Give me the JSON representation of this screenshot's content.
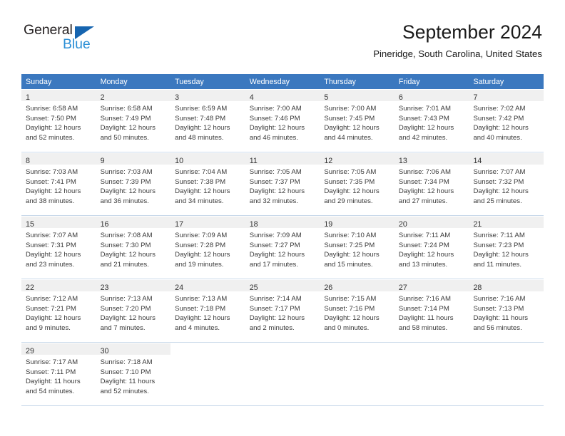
{
  "brand": {
    "name_part1": "General",
    "name_part2": "Blue",
    "accent_color": "#1665b0",
    "blue_text_color": "#2b8fd6"
  },
  "header": {
    "title": "September 2024",
    "location": "Pineridge, South Carolina, United States"
  },
  "theme": {
    "header_bar_color": "#3b78bf",
    "header_text_color": "#ffffff",
    "day_band_color": "#f0f0f0",
    "row_divider_color": "#c9d9ea",
    "body_text_color": "#3a3a3a"
  },
  "weekdays": [
    "Sunday",
    "Monday",
    "Tuesday",
    "Wednesday",
    "Thursday",
    "Friday",
    "Saturday"
  ],
  "weeks": [
    [
      {
        "day": "1",
        "sunrise": "Sunrise: 6:58 AM",
        "sunset": "Sunset: 7:50 PM",
        "daylight": "Daylight: 12 hours and 52 minutes."
      },
      {
        "day": "2",
        "sunrise": "Sunrise: 6:58 AM",
        "sunset": "Sunset: 7:49 PM",
        "daylight": "Daylight: 12 hours and 50 minutes."
      },
      {
        "day": "3",
        "sunrise": "Sunrise: 6:59 AM",
        "sunset": "Sunset: 7:48 PM",
        "daylight": "Daylight: 12 hours and 48 minutes."
      },
      {
        "day": "4",
        "sunrise": "Sunrise: 7:00 AM",
        "sunset": "Sunset: 7:46 PM",
        "daylight": "Daylight: 12 hours and 46 minutes."
      },
      {
        "day": "5",
        "sunrise": "Sunrise: 7:00 AM",
        "sunset": "Sunset: 7:45 PM",
        "daylight": "Daylight: 12 hours and 44 minutes."
      },
      {
        "day": "6",
        "sunrise": "Sunrise: 7:01 AM",
        "sunset": "Sunset: 7:43 PM",
        "daylight": "Daylight: 12 hours and 42 minutes."
      },
      {
        "day": "7",
        "sunrise": "Sunrise: 7:02 AM",
        "sunset": "Sunset: 7:42 PM",
        "daylight": "Daylight: 12 hours and 40 minutes."
      }
    ],
    [
      {
        "day": "8",
        "sunrise": "Sunrise: 7:03 AM",
        "sunset": "Sunset: 7:41 PM",
        "daylight": "Daylight: 12 hours and 38 minutes."
      },
      {
        "day": "9",
        "sunrise": "Sunrise: 7:03 AM",
        "sunset": "Sunset: 7:39 PM",
        "daylight": "Daylight: 12 hours and 36 minutes."
      },
      {
        "day": "10",
        "sunrise": "Sunrise: 7:04 AM",
        "sunset": "Sunset: 7:38 PM",
        "daylight": "Daylight: 12 hours and 34 minutes."
      },
      {
        "day": "11",
        "sunrise": "Sunrise: 7:05 AM",
        "sunset": "Sunset: 7:37 PM",
        "daylight": "Daylight: 12 hours and 32 minutes."
      },
      {
        "day": "12",
        "sunrise": "Sunrise: 7:05 AM",
        "sunset": "Sunset: 7:35 PM",
        "daylight": "Daylight: 12 hours and 29 minutes."
      },
      {
        "day": "13",
        "sunrise": "Sunrise: 7:06 AM",
        "sunset": "Sunset: 7:34 PM",
        "daylight": "Daylight: 12 hours and 27 minutes."
      },
      {
        "day": "14",
        "sunrise": "Sunrise: 7:07 AM",
        "sunset": "Sunset: 7:32 PM",
        "daylight": "Daylight: 12 hours and 25 minutes."
      }
    ],
    [
      {
        "day": "15",
        "sunrise": "Sunrise: 7:07 AM",
        "sunset": "Sunset: 7:31 PM",
        "daylight": "Daylight: 12 hours and 23 minutes."
      },
      {
        "day": "16",
        "sunrise": "Sunrise: 7:08 AM",
        "sunset": "Sunset: 7:30 PM",
        "daylight": "Daylight: 12 hours and 21 minutes."
      },
      {
        "day": "17",
        "sunrise": "Sunrise: 7:09 AM",
        "sunset": "Sunset: 7:28 PM",
        "daylight": "Daylight: 12 hours and 19 minutes."
      },
      {
        "day": "18",
        "sunrise": "Sunrise: 7:09 AM",
        "sunset": "Sunset: 7:27 PM",
        "daylight": "Daylight: 12 hours and 17 minutes."
      },
      {
        "day": "19",
        "sunrise": "Sunrise: 7:10 AM",
        "sunset": "Sunset: 7:25 PM",
        "daylight": "Daylight: 12 hours and 15 minutes."
      },
      {
        "day": "20",
        "sunrise": "Sunrise: 7:11 AM",
        "sunset": "Sunset: 7:24 PM",
        "daylight": "Daylight: 12 hours and 13 minutes."
      },
      {
        "day": "21",
        "sunrise": "Sunrise: 7:11 AM",
        "sunset": "Sunset: 7:23 PM",
        "daylight": "Daylight: 12 hours and 11 minutes."
      }
    ],
    [
      {
        "day": "22",
        "sunrise": "Sunrise: 7:12 AM",
        "sunset": "Sunset: 7:21 PM",
        "daylight": "Daylight: 12 hours and 9 minutes."
      },
      {
        "day": "23",
        "sunrise": "Sunrise: 7:13 AM",
        "sunset": "Sunset: 7:20 PM",
        "daylight": "Daylight: 12 hours and 7 minutes."
      },
      {
        "day": "24",
        "sunrise": "Sunrise: 7:13 AM",
        "sunset": "Sunset: 7:18 PM",
        "daylight": "Daylight: 12 hours and 4 minutes."
      },
      {
        "day": "25",
        "sunrise": "Sunrise: 7:14 AM",
        "sunset": "Sunset: 7:17 PM",
        "daylight": "Daylight: 12 hours and 2 minutes."
      },
      {
        "day": "26",
        "sunrise": "Sunrise: 7:15 AM",
        "sunset": "Sunset: 7:16 PM",
        "daylight": "Daylight: 12 hours and 0 minutes."
      },
      {
        "day": "27",
        "sunrise": "Sunrise: 7:16 AM",
        "sunset": "Sunset: 7:14 PM",
        "daylight": "Daylight: 11 hours and 58 minutes."
      },
      {
        "day": "28",
        "sunrise": "Sunrise: 7:16 AM",
        "sunset": "Sunset: 7:13 PM",
        "daylight": "Daylight: 11 hours and 56 minutes."
      }
    ],
    [
      {
        "day": "29",
        "sunrise": "Sunrise: 7:17 AM",
        "sunset": "Sunset: 7:11 PM",
        "daylight": "Daylight: 11 hours and 54 minutes."
      },
      {
        "day": "30",
        "sunrise": "Sunrise: 7:18 AM",
        "sunset": "Sunset: 7:10 PM",
        "daylight": "Daylight: 11 hours and 52 minutes."
      },
      {
        "day": "",
        "sunrise": "",
        "sunset": "",
        "daylight": ""
      },
      {
        "day": "",
        "sunrise": "",
        "sunset": "",
        "daylight": ""
      },
      {
        "day": "",
        "sunrise": "",
        "sunset": "",
        "daylight": ""
      },
      {
        "day": "",
        "sunrise": "",
        "sunset": "",
        "daylight": ""
      },
      {
        "day": "",
        "sunrise": "",
        "sunset": "",
        "daylight": ""
      }
    ]
  ]
}
